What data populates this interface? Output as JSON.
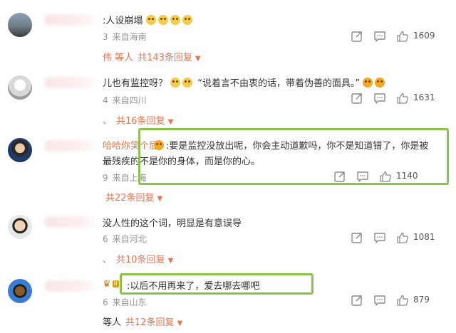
{
  "comments": [
    {
      "name_frag": "",
      "text": ":人设崩塌",
      "time_frag": "3",
      "location": "来自海南",
      "likes": "1609",
      "replies": {
        "who": "伟 等人",
        "count_text": "共143条回复"
      }
    },
    {
      "name_frag": "",
      "text": "儿也有监控呀？",
      "quote": "“说着言不由衷的话，带着伪善的面具。”",
      "time_frag": "4",
      "location": "来自四川",
      "likes": "1631",
      "replies": {
        "who": "、",
        "count_text": "共16条回复"
      }
    },
    {
      "name_frag": "哈哈你笑个屁",
      "text_line1": ":要是监控没放出呢，你会主动道歉吗，你不是知道错了，你是被",
      "text_line2": "最残疾的不是你的身体，而是你的心。",
      "time_frag": "9",
      "location": "来自上海",
      "likes": "1140",
      "replies": {
        "who": "",
        "count_text": "共22条回复"
      }
    },
    {
      "name_frag": "",
      "text": "没人性的这个词，明显是有意误导",
      "time_frag": "6",
      "location": "来自河北",
      "likes": "1081",
      "replies": {
        "who": "、",
        "count_text": "共10条回复"
      }
    },
    {
      "name_frag": "",
      "badge": "II",
      "text": ":以后不用再来了，爱去哪去哪吧",
      "time_frag": "6",
      "location": "来自山东",
      "likes": "879",
      "replies": {
        "who": "等人",
        "count_text": "共12条回复"
      }
    }
  ],
  "colors": {
    "accent": "#eb7350",
    "highlight_box": "#8bc34a",
    "meta": "#939393"
  },
  "icons": [
    "share-icon",
    "comment-icon",
    "like-icon",
    "caret-down-icon",
    "smiley-emoji-icon",
    "crown-badge-icon"
  ]
}
